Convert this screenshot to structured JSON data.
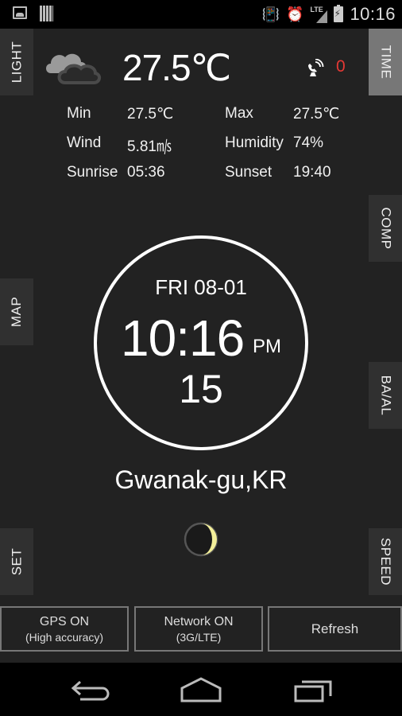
{
  "status_bar": {
    "time": "10:16",
    "network_type": "LTE",
    "icons": [
      "image-notification-icon",
      "barcode-notification-icon",
      "vibrate-icon",
      "alarm-icon",
      "signal-icon",
      "battery-charging-icon"
    ]
  },
  "side_tabs": {
    "left": [
      {
        "id": "light",
        "label": "LIGHT"
      },
      {
        "id": "map",
        "label": "MAP"
      },
      {
        "id": "set",
        "label": "SET"
      }
    ],
    "right": [
      {
        "id": "time",
        "label": "TIME",
        "active": true
      },
      {
        "id": "comp",
        "label": "COMP"
      },
      {
        "id": "baal",
        "label": "BA/AL"
      },
      {
        "id": "speed",
        "label": "SPEED"
      }
    ]
  },
  "weather": {
    "icon": "cloudy-icon",
    "temperature": "27.5℃",
    "satellite_count": "0",
    "rows": [
      {
        "label1": "Min",
        "value1": "27.5℃",
        "label2": "Max",
        "value2": "27.5℃"
      },
      {
        "label1": "Wind",
        "value1": "5.81㎧",
        "label2": "Humidity",
        "value2": "74%"
      },
      {
        "label1": "Sunrise",
        "value1": "05:36",
        "label2": "Sunset",
        "value2": "19:40"
      }
    ]
  },
  "clock": {
    "date": "FRI 08-01",
    "time": "10:16",
    "ampm": "PM",
    "seconds": "15"
  },
  "location": "Gwanak-gu,KR",
  "moon_phase": "waxing-crescent",
  "buttons": {
    "gps": {
      "line1": "GPS ON",
      "line2": "(High accuracy)"
    },
    "network": {
      "line1": "Network ON",
      "line2": "(3G/LTE)"
    },
    "refresh": {
      "line1": "Refresh"
    }
  },
  "colors": {
    "background": "#222222",
    "tab": "#303030",
    "tab_active": "#777777",
    "satellite_count": "#e53935",
    "moon": "#f3ef9a"
  }
}
